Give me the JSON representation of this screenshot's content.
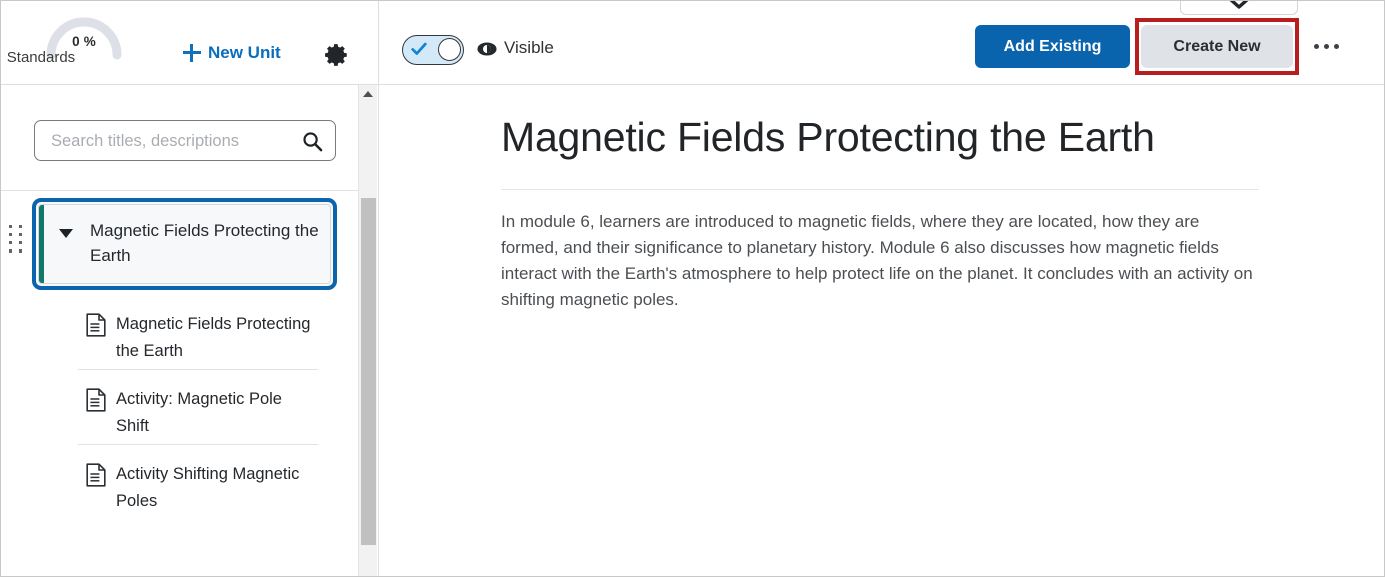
{
  "topbar": {
    "gauge": {
      "percent_label": "0 %",
      "caption": "Standards",
      "value": 0,
      "arc_color": "#dde0e6"
    },
    "new_unit_label": "New Unit",
    "new_unit_icon": "plus-icon",
    "settings_icon": "gear-icon",
    "visibility": {
      "toggle_state": "on",
      "toggle_icon": "check-icon",
      "eye_icon": "eye-icon",
      "label": "Visible"
    },
    "peek_select": {
      "icon": "chevron-down-icon"
    },
    "add_existing_label": "Add Existing",
    "create_new_label": "Create New",
    "more_icon": "ellipsis-icon",
    "accent_blue": "#0a64ad",
    "secondary_button_bg": "#dfe3e8",
    "annotation_color": "#b81e1e"
  },
  "sidebar": {
    "search": {
      "placeholder": "Search titles, descriptions",
      "value": "",
      "icon": "search-icon"
    },
    "unit": {
      "title": "Magnetic Fields Protecting the Earth",
      "expanded": true,
      "caret_icon": "caret-down-icon",
      "drag_icon": "drag-handle-icon",
      "accent_color": "#12786c",
      "focus_color": "#0c64ad"
    },
    "topics": [
      {
        "label": "Magnetic Fields Protecting the Earth",
        "icon": "document-icon"
      },
      {
        "label": "Activity: Magnetic Pole Shift",
        "icon": "document-icon"
      },
      {
        "label": "Activity Shifting Magnetic Poles",
        "icon": "document-icon"
      }
    ],
    "scrollbar": {
      "up_icon": "scroll-up-arrow-icon"
    }
  },
  "main": {
    "title": "Magnetic Fields Protecting the Earth",
    "description": "In module 6, learners are introduced to magnetic fields, where they are located, how they are formed, and their significance to planetary history. Module 6 also discusses how magnetic fields interact with the Earth's atmosphere to help protect life on the planet. It concludes with an activity on shifting magnetic poles."
  }
}
